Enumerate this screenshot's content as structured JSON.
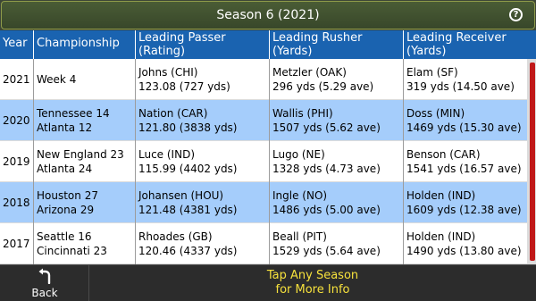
{
  "header": {
    "title": "Season 6 (2021)",
    "help_label": "?"
  },
  "table": {
    "columns": [
      {
        "line1": "Year",
        "line2": ""
      },
      {
        "line1": "Championship",
        "line2": ""
      },
      {
        "line1": "Leading Passer",
        "line2": "(Rating)"
      },
      {
        "line1": "Leading Rusher",
        "line2": "(Yards)"
      },
      {
        "line1": "Leading Receiver",
        "line2": "(Yards)"
      }
    ],
    "rows": [
      {
        "year": "2021",
        "champ1": "Week 4",
        "champ2": "",
        "pass1": "Johns (CHI)",
        "pass2": "123.08 (727 yds)",
        "rush1": "Metzler (OAK)",
        "rush2": "296 yds (5.29 ave)",
        "rec1": "Elam (SF)",
        "rec2": "319 yds (14.50 ave)"
      },
      {
        "year": "2020",
        "champ1": "Tennessee 14",
        "champ2": "Atlanta 12",
        "pass1": "Nation (CAR)",
        "pass2": "121.80 (3838 yds)",
        "rush1": "Wallis (PHI)",
        "rush2": "1507 yds (5.62 ave)",
        "rec1": "Doss (MIN)",
        "rec2": "1469 yds (15.30 ave)"
      },
      {
        "year": "2019",
        "champ1": "New England 23",
        "champ2": "Atlanta 24",
        "pass1": "Luce (IND)",
        "pass2": "115.99 (4402 yds)",
        "rush1": "Lugo (NE)",
        "rush2": "1328 yds (4.73 ave)",
        "rec1": "Benson (CAR)",
        "rec2": "1541 yds (16.57 ave)"
      },
      {
        "year": "2018",
        "champ1": "Houston 27",
        "champ2": "Arizona 29",
        "pass1": "Johansen (HOU)",
        "pass2": "121.48 (4381 yds)",
        "rush1": "Ingle (NO)",
        "rush2": "1486 yds (5.00 ave)",
        "rec1": "Holden (IND)",
        "rec2": "1609 yds (12.38 ave)"
      },
      {
        "year": "2017",
        "champ1": "Seattle 16",
        "champ2": "Cincinnati 23",
        "pass1": "Rhoades (GB)",
        "pass2": "120.46 (4337 yds)",
        "rush1": "Beall (PIT)",
        "rush2": "1529 yds (5.64 ave)",
        "rec1": "Holden (IND)",
        "rec2": "1490 yds (13.80 ave)"
      }
    ]
  },
  "footer": {
    "back_label": "Back",
    "info_line1": "Tap Any Season",
    "info_line2": "for More Info"
  },
  "colors": {
    "header_blue": "#1a63b0",
    "row_blue": "#a5cdfb",
    "accent_yellow": "#f6e13c",
    "scroll_red": "#c01818"
  }
}
